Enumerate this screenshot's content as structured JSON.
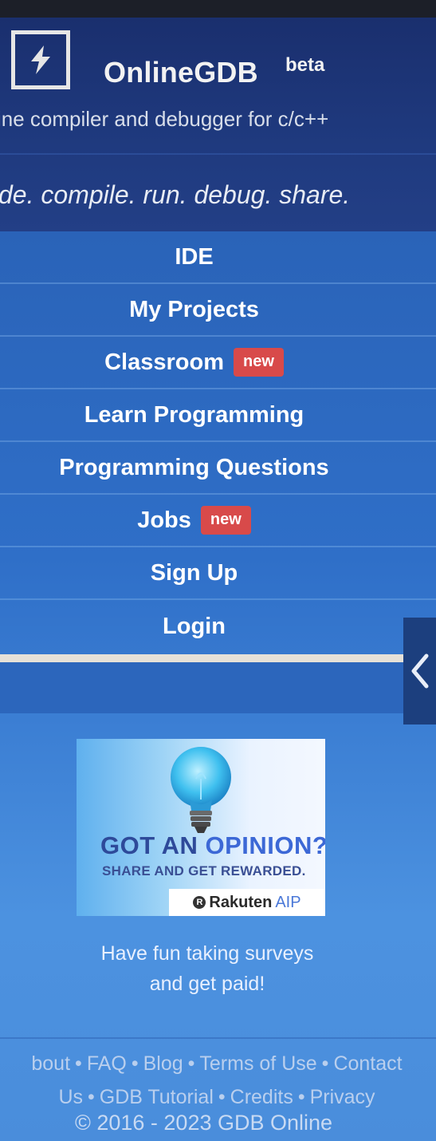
{
  "header": {
    "brand": "OnlineGDB",
    "beta": "beta",
    "tagline": "ine compiler and debugger for c/c++",
    "motto": "de. compile. run. debug. share."
  },
  "nav": {
    "items": [
      {
        "label": "IDE"
      },
      {
        "label": "My Projects"
      },
      {
        "label": "Classroom",
        "badge": "new"
      },
      {
        "label": "Learn Programming"
      },
      {
        "label": "Programming Questions"
      },
      {
        "label": "Jobs",
        "badge": "new"
      },
      {
        "label": "Sign Up"
      },
      {
        "label": "Login"
      }
    ]
  },
  "ad": {
    "title_part1": "GOT AN ",
    "title_part2": "OPINION?",
    "subtitle": "SHARE AND GET REWARDED.",
    "brand": "Rakuten",
    "brand_sub": "AIP",
    "brand_mark": "R"
  },
  "promo": {
    "line1": "Have fun taking surveys",
    "line2": "and get paid!"
  },
  "footer": {
    "links": [
      "bout",
      "FAQ",
      "Blog",
      "Terms of Use",
      "Contact",
      "Us",
      "GDB Tutorial",
      "Credits",
      "Privacy"
    ],
    "separator": "•",
    "copyright": "© 2016 - 2023 GDB Online"
  },
  "colors": {
    "accent": "#2f6fc8",
    "badge": "#d84a4a",
    "header": "#1f3a7f"
  },
  "icons": {
    "logo": "bolt-icon",
    "collapse": "chevron-left-icon",
    "ad": "lightbulb-icon"
  }
}
